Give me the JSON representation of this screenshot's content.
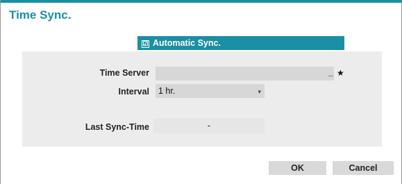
{
  "dialog": {
    "title": "Time Sync."
  },
  "auto_sync": {
    "label": "Automatic Sync.",
    "checked": true,
    "check_glyph": "☑"
  },
  "time_server": {
    "label": "Time Server",
    "value": "",
    "clear_glyph": "_",
    "favorite_glyph": "★"
  },
  "interval": {
    "label": "Interval",
    "value": "1 hr.",
    "arrow_glyph": "▾"
  },
  "last_sync": {
    "label": "Last Sync-Time",
    "value": "-"
  },
  "buttons": {
    "ok": "OK",
    "cancel": "Cancel"
  },
  "colors": {
    "accent": "#1a8fa6",
    "panel": "#ececec",
    "field": "#d7d7d7",
    "button": "#d9d9d9"
  }
}
